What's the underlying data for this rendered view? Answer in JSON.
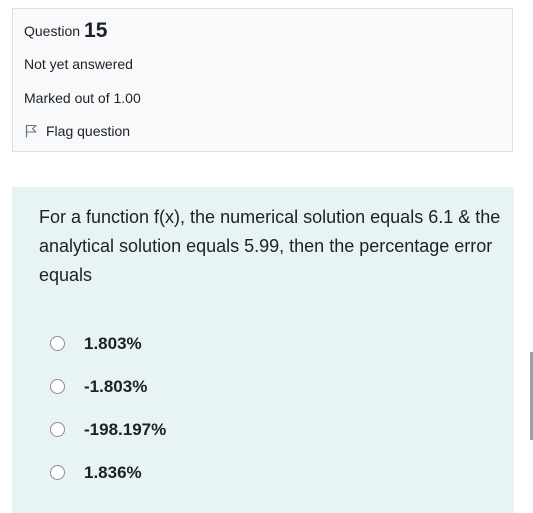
{
  "question_info": {
    "prefix": "Question",
    "number": "15",
    "state": "Not yet answered",
    "grade": "Marked out of 1.00",
    "flag_label": "Flag question",
    "flag_icon": "flag-icon"
  },
  "question": {
    "text": "For a function f(x), the numerical solution equals 6.1 & the analytical solution equals 5.99, then the percentage error equals",
    "options": [
      {
        "label": "1.803%"
      },
      {
        "label": "-1.803%"
      },
      {
        "label": "-198.197%"
      },
      {
        "label": "1.836%"
      }
    ]
  },
  "colors": {
    "info_background": "#f8f9fa",
    "content_background": "#e7f3f5",
    "text": "#1d2125"
  }
}
